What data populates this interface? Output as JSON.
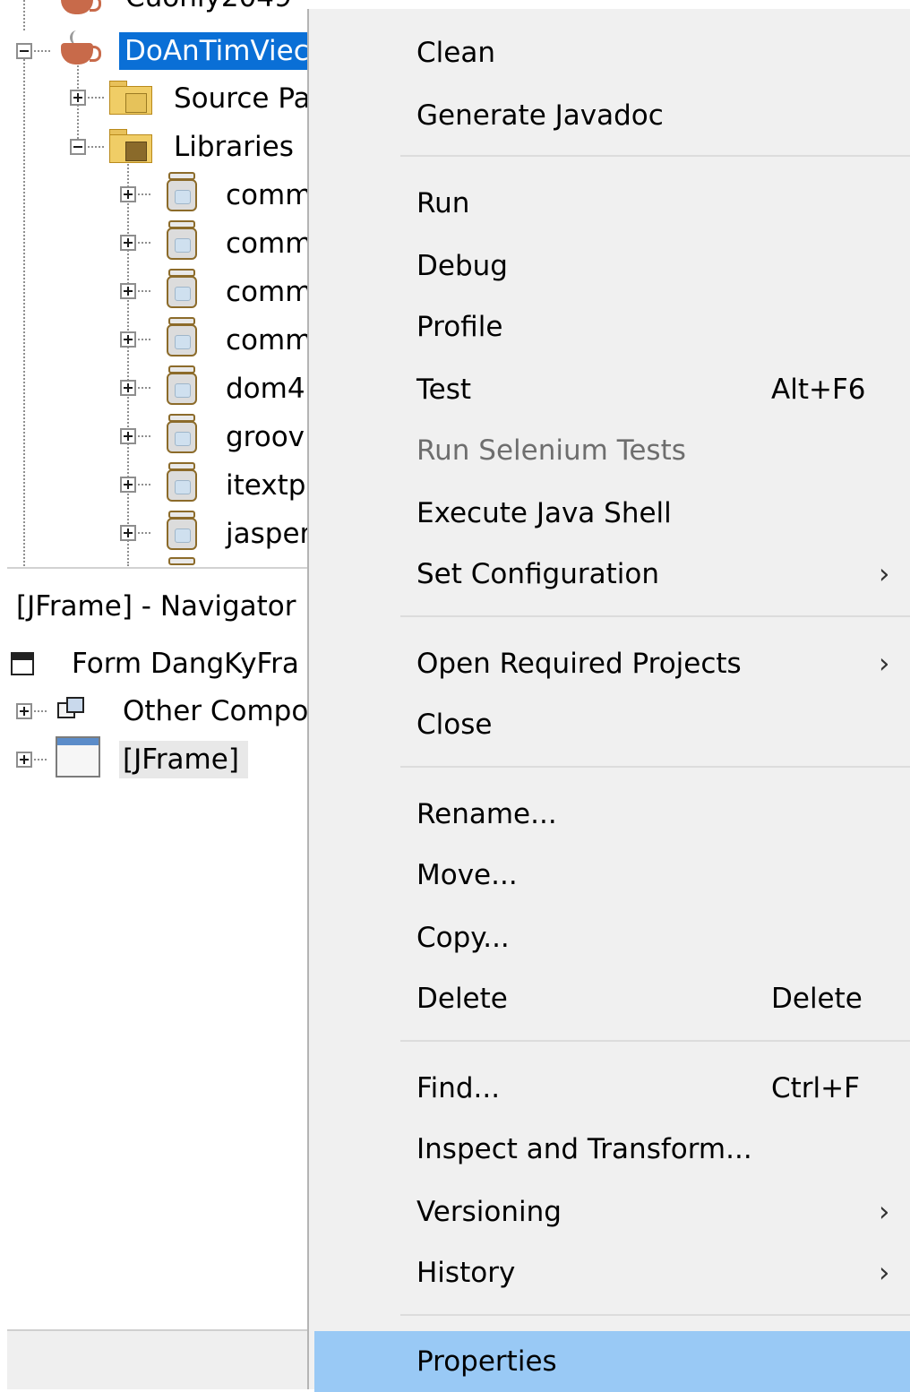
{
  "project_tree": {
    "partial_top_item": "Cuonly2049",
    "project": "DoAnTimViec",
    "source_packages": "Source Pa",
    "libraries": "Libraries",
    "library_items": [
      "comm",
      "comm",
      "comm",
      "comm",
      "dom4",
      "groov",
      "itextp",
      "jasper"
    ]
  },
  "navigator": {
    "title": "[JFrame] - Navigator",
    "items": [
      "Form DangKyFra",
      "Other Compo",
      "[JFrame]"
    ]
  },
  "context_menu": {
    "items": [
      {
        "label": "Clean"
      },
      {
        "label": "Generate Javadoc"
      },
      {
        "label": "Run"
      },
      {
        "label": "Debug"
      },
      {
        "label": "Profile"
      },
      {
        "label": "Test",
        "shortcut": "Alt+F6"
      },
      {
        "label": "Run Selenium Tests",
        "disabled": true
      },
      {
        "label": "Execute Java Shell"
      },
      {
        "label": "Set Configuration",
        "submenu": true
      },
      {
        "label": "Open Required Projects",
        "submenu": true
      },
      {
        "label": "Close"
      },
      {
        "label": "Rename..."
      },
      {
        "label": "Move..."
      },
      {
        "label": "Copy..."
      },
      {
        "label": "Delete",
        "shortcut": "Delete"
      },
      {
        "label": "Find...",
        "shortcut": "Ctrl+F"
      },
      {
        "label": "Inspect and Transform..."
      },
      {
        "label": "Versioning",
        "submenu": true
      },
      {
        "label": "History",
        "submenu": true
      },
      {
        "label": "Properties",
        "highlighted": true
      }
    ],
    "submenu_arrow": "›"
  },
  "colors": {
    "selection": "#0a6fd6",
    "menu_background": "#f0f0f0",
    "menu_highlight": "#99c9f5",
    "disabled_text": "#6e6e6e"
  }
}
